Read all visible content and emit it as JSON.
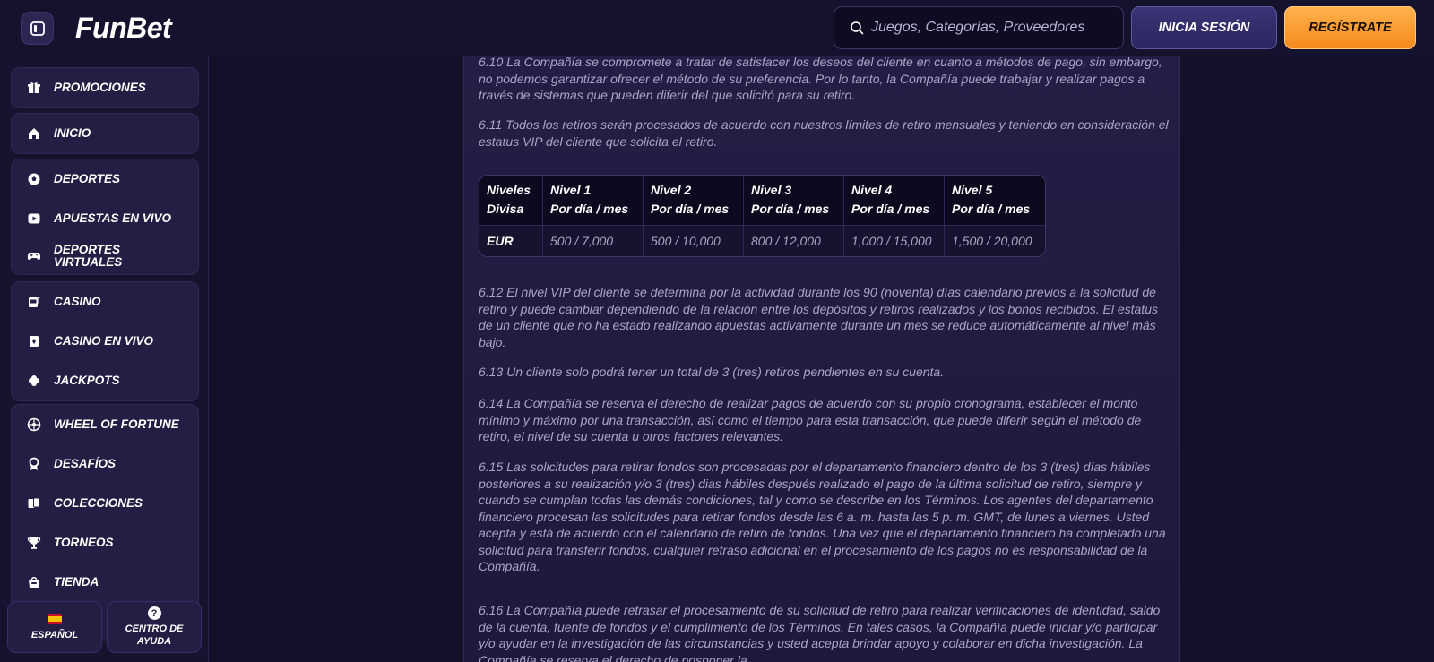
{
  "header": {
    "logo": "FunBet",
    "search_placeholder": "Juegos, Categorías, Proveedores",
    "login_label": "INICIA SESIÓN",
    "register_label": "REGÍSTRATE"
  },
  "sidebar": {
    "groups": [
      [
        {
          "label": "PROMOCIONES",
          "icon": "gift-icon"
        }
      ],
      [
        {
          "label": "INICIO",
          "icon": "home-icon"
        }
      ],
      [
        {
          "label": "DEPORTES",
          "icon": "soccer-ball-icon"
        },
        {
          "label": "APUESTAS EN VIVO",
          "icon": "live-play-icon"
        },
        {
          "label": "DEPORTES VIRTUALES",
          "icon": "gamepad-icon"
        }
      ],
      [
        {
          "label": "CASINO",
          "icon": "slot-machine-icon"
        },
        {
          "label": "CASINO EN VIVO",
          "icon": "cards-icon"
        },
        {
          "label": "JACKPOTS",
          "icon": "clover-icon"
        }
      ],
      [
        {
          "label": "WHEEL OF FORTUNE",
          "icon": "wheel-icon"
        },
        {
          "label": "DESAFÍOS",
          "icon": "medal-icon"
        },
        {
          "label": "COLECCIONES",
          "icon": "collection-cards-icon"
        },
        {
          "label": "TORNEOS",
          "icon": "trophy-icon"
        },
        {
          "label": "TIENDA",
          "icon": "shop-icon"
        }
      ]
    ],
    "language_label": "ESPAÑOL",
    "help_label_1": "CENTRO DE",
    "help_label_2": "AYUDA"
  },
  "content": {
    "p_6_10": "6.10 La Compañía se compromete a tratar de satisfacer los deseos del cliente en cuanto a métodos de pago, sin embargo, no podemos garantizar ofrecer el método de su preferencia. Por lo tanto, la Compañía puede trabajar y realizar pagos a través de sistemas que pueden diferir del que solicitó para su retiro.",
    "p_6_11": "6.11 Todos los retiros serán procesados de acuerdo con nuestros límites de retiro mensuales y teniendo en consideración el estatus VIP del cliente que solicita el retiro.",
    "table": {
      "header_col": [
        "Niveles",
        "Divisa"
      ],
      "levels": [
        [
          "Nivel 1",
          "Por día / mes"
        ],
        [
          "Nivel 2",
          "Por día / mes"
        ],
        [
          "Nivel 3",
          "Por día / mes"
        ],
        [
          "Nivel 4",
          "Por día / mes"
        ],
        [
          "Nivel 5",
          "Por día / mes"
        ]
      ],
      "row_currency": "EUR",
      "row_values": [
        "500 / 7,000",
        "500 / 10,000",
        "800 / 12,000",
        "1,000 / 15,000",
        "1,500 / 20,000"
      ]
    },
    "p_6_12": "6.12 El nivel VIP del cliente se determina por la actividad durante los 90 (noventa) días calendario previos a la solicitud de retiro y puede cambiar dependiendo de la relación entre los depósitos y retiros realizados y los bonos recibidos. El estatus de un cliente que no ha estado realizando apuestas activamente durante un mes se reduce automáticamente al nivel más bajo.",
    "p_6_13": "6.13 Un cliente solo podrá tener un total de 3 (tres) retiros pendientes en su cuenta.",
    "p_6_14": "6.14 La Compañía se reserva el derecho de realizar pagos de acuerdo con su propio cronograma, establecer el monto mínimo y máximo por una transacción, así como el tiempo para esta transacción, que puede diferir según el método de retiro, el nivel de su cuenta u otros factores relevantes.",
    "p_6_15": "6.15 Las solicitudes para retirar fondos son procesadas por el departamento financiero dentro de los 3 (tres) días hábiles posteriores a su realización y/o 3 (tres) dias hábiles después realizado el pago de la última solicitud de retiro, siempre y cuando se cumplan todas las demás condiciones, tal y como se describe en los Términos. Los agentes del departamento financiero procesan las solicitudes para retirar fondos desde las 6 a. m. hasta las 5 p. m. GMT, de lunes a viernes. Usted acepta y está de acuerdo con el calendario de retiro de fondos. Una vez que el departamento financiero ha completado una solicitud para transferir fondos, cualquier retraso adicional en el procesamiento de los pagos no es responsabilidad de la Compañía.",
    "p_6_16": "6.16 La Compañía puede retrasar el procesamiento de su solicitud de retiro para realizar verificaciones de identidad, saldo de la cuenta, fuente de fondos y el cumplimiento de los Términos. En tales casos, la Compañía puede iniciar y/o participar y/o ayudar en la investigación de las circunstancias y usted acepta brindar apoyo y colaborar en dicha investigación. La Compañía se reserva el derecho de posponer la"
  }
}
